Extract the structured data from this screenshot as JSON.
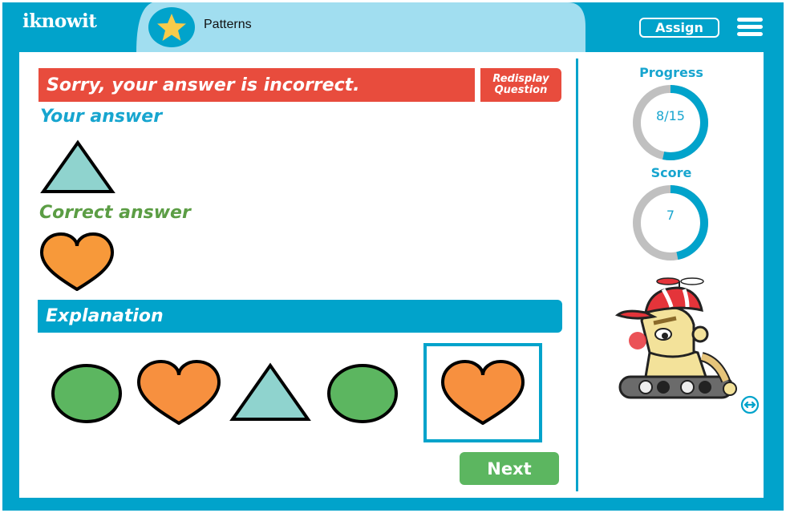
{
  "header": {
    "logo": "iknowit",
    "lesson_title": "Patterns",
    "assign_label": "Assign",
    "menu_icon": "hamburger-menu-icon",
    "lesson_icon": "star-icon"
  },
  "feedback": {
    "result_message": "Sorry, your answer is incorrect.",
    "redisplay_label_line1": "Redisplay",
    "redisplay_label_line2": "Question",
    "your_answer_label": "Your answer",
    "your_answer_shape": "triangle",
    "correct_answer_label": "Correct answer",
    "correct_answer_shape": "heart"
  },
  "explanation": {
    "title": "Explanation",
    "sequence": [
      "circle",
      "heart",
      "triangle",
      "circle"
    ],
    "answer": "heart"
  },
  "actions": {
    "next_label": "Next"
  },
  "sidebar": {
    "progress_label": "Progress",
    "progress_value": "8/15",
    "progress_fraction": 0.533,
    "score_label": "Score",
    "score_value": "7",
    "score_fraction": 0.467,
    "mascot": "robot-mascot",
    "toggle_icon": "expand-horizontal-icon"
  },
  "colors": {
    "brand_blue": "#01a3cb",
    "tab_light_blue": "#a1def0",
    "error_red": "#e84c3d",
    "correct_green": "#5b9d44",
    "button_green": "#5cb660",
    "shape_green": "#5cb660",
    "shape_orange": "#f7903f",
    "shape_teal": "#8fd3ce",
    "ring_gray": "#c0c0c0"
  }
}
